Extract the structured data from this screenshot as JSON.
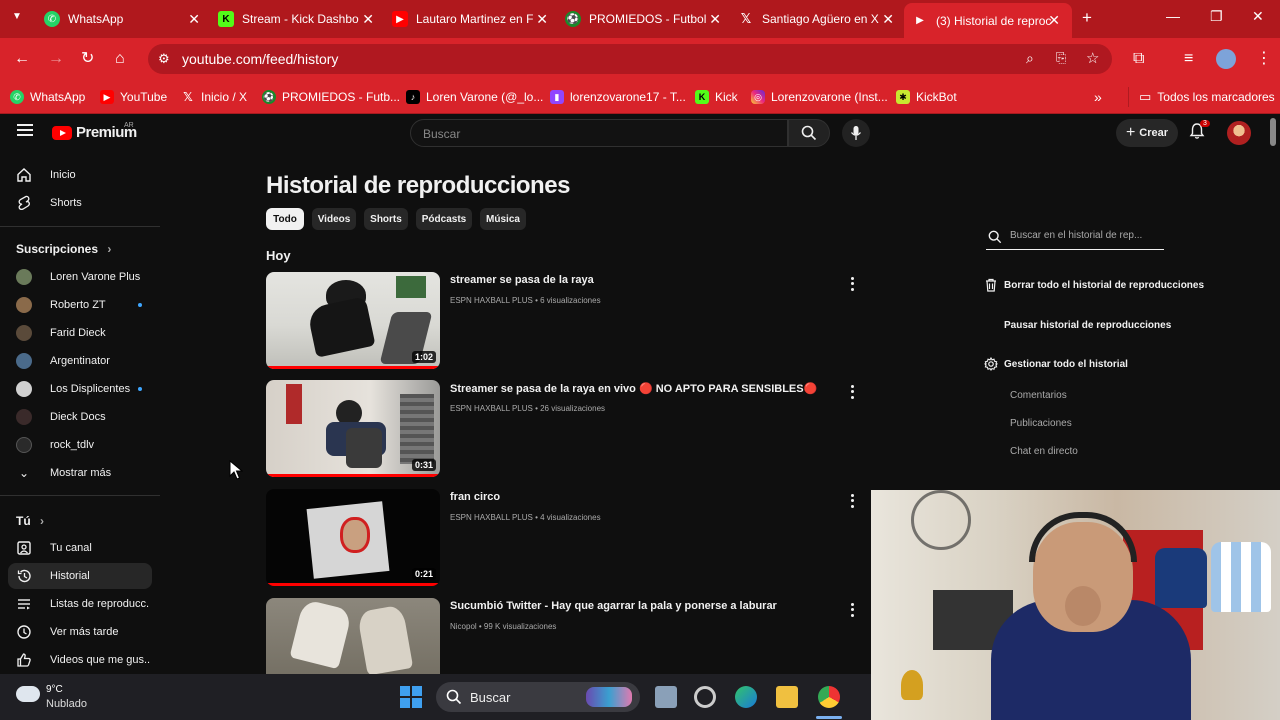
{
  "browser": {
    "tabs": [
      {
        "label": "WhatsApp",
        "icon": "whatsapp-icon"
      },
      {
        "label": "Stream - Kick Dashbo",
        "icon": "kick-icon"
      },
      {
        "label": "Lautaro Martinez en F",
        "icon": "youtube-icon"
      },
      {
        "label": "PROMIEDOS - Futbol",
        "icon": "promiedos-icon"
      },
      {
        "label": "Santiago Agüero en X",
        "icon": "x-icon"
      },
      {
        "label": "(3) Historial de reproc",
        "icon": "youtube-icon",
        "active": true
      }
    ],
    "new_tab": "+",
    "url": "youtube.com/feed/history",
    "bookmarks": [
      {
        "label": "WhatsApp",
        "icon": "whatsapp-icon"
      },
      {
        "label": "YouTube",
        "icon": "youtube-icon"
      },
      {
        "label": "Inicio / X",
        "icon": "x-icon"
      },
      {
        "label": "PROMIEDOS - Futb...",
        "icon": "promiedos-icon"
      },
      {
        "label": "Loren Varone (@_lo...",
        "icon": "tiktok-icon"
      },
      {
        "label": "lorenzovarone17 - T...",
        "icon": "twitch-icon"
      },
      {
        "label": "Kick",
        "icon": "kick-icon"
      },
      {
        "label": "Lorenzovarone (Inst...",
        "icon": "instagram-icon"
      },
      {
        "label": "KickBot",
        "icon": "kickbot-icon"
      }
    ],
    "bookmarks_overflow": "»",
    "all_bookmarks": "Todos los marcadores"
  },
  "youtube": {
    "logo": "Premium",
    "country": "AR",
    "search_placeholder": "Buscar",
    "create_label": "Crear",
    "notification_count": "3",
    "sidebar": {
      "main": [
        {
          "label": "Inicio",
          "icon": "home-icon"
        },
        {
          "label": "Shorts",
          "icon": "shorts-icon"
        }
      ],
      "subscriptions_title": "Suscripciones",
      "subscriptions": [
        {
          "label": "Loren Varone Plus",
          "live": false,
          "color": "#6a7a5a"
        },
        {
          "label": "Roberto ZT",
          "live": true,
          "color": "#8a6a4a"
        },
        {
          "label": "Farid Dieck",
          "live": false,
          "color": "#5a4a3a"
        },
        {
          "label": "Argentinator",
          "live": false,
          "color": "#4a6a8a"
        },
        {
          "label": "Los Displicentes",
          "live": true,
          "color": "#d0d0d0"
        },
        {
          "label": "Dieck Docs",
          "live": false,
          "color": "#3a2a2a"
        },
        {
          "label": "rock_tdlv",
          "live": false,
          "color": "#2a2a2a"
        }
      ],
      "show_more": "Mostrar más",
      "you_title": "Tú",
      "you": [
        {
          "label": "Tu canal",
          "icon": "channel-icon",
          "active": false
        },
        {
          "label": "Historial",
          "icon": "history-icon",
          "active": true
        },
        {
          "label": "Listas de reproducc...",
          "icon": "playlists-icon",
          "active": false
        },
        {
          "label": "Ver más tarde",
          "icon": "watch-later-icon",
          "active": false
        },
        {
          "label": "Videos que me gus...",
          "icon": "like-icon",
          "active": false
        }
      ]
    },
    "page_title": "Historial de reproducciones",
    "chips": [
      "Todo",
      "Videos",
      "Shorts",
      "Pódcasts",
      "Música"
    ],
    "section": "Hoy",
    "videos": [
      {
        "title": "streamer se pasa de la raya",
        "meta": "ESPN HAXBALL PLUS • 6 visualizaciones",
        "duration": "1:02",
        "watched": 1.0
      },
      {
        "title": "Streamer se pasa de la raya en vivo 🔴 NO APTO PARA SENSIBLES🔴",
        "meta": "ESPN HAXBALL PLUS • 26 visualizaciones",
        "duration": "0:31",
        "watched": 1.0
      },
      {
        "title": "fran circo",
        "meta": "ESPN HAXBALL PLUS • 4 visualizaciones",
        "duration": "0:21",
        "watched": 1.0
      },
      {
        "title": "Sucumbió Twitter - Hay que agarrar la pala y ponerse a laburar",
        "meta": "Nicopol • 99 K visualizaciones",
        "duration": "",
        "watched": 0
      }
    ],
    "right_panel": {
      "search_placeholder": "Buscar en el historial de rep...",
      "clear_all": "Borrar todo el historial de reproducciones",
      "pause": "Pausar historial de reproducciones",
      "manage": "Gestionar todo el historial",
      "sub_items": [
        "Comentarios",
        "Publicaciones",
        "Chat en directo"
      ]
    }
  },
  "taskbar": {
    "temperature": "9°C",
    "weather": "Nublado",
    "search_label": "Buscar"
  },
  "colors": {
    "chrome_red": "#d8232a",
    "yt_background": "#0f0f0f",
    "yt_red": "#ff0000"
  }
}
